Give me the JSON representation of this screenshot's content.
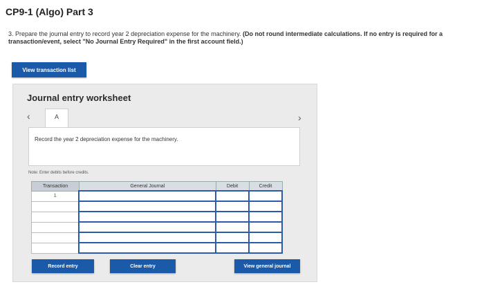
{
  "title": "CP9-1 (Algo) Part 3",
  "question": {
    "text": "3. Prepare the journal entry to record year 2 depreciation expense for the machinery.",
    "bold": "(Do not round intermediate calculations. If no entry is required for a transaction/event, select \"No Journal Entry Required\" in the first account field.)"
  },
  "view_transaction_label": "View transaction list",
  "worksheet": {
    "title": "Journal entry worksheet",
    "prev_icon": "chevron-left-icon",
    "next_icon": "chevron-right-icon",
    "tab_label": "A",
    "description": "Record the year 2 depreciation expense for the machinery.",
    "note": "Note: Enter debits before credits."
  },
  "table": {
    "headers": [
      "Transaction",
      "General Journal",
      "Debit",
      "Credit"
    ],
    "rows": [
      [
        "1",
        "",
        "",
        ""
      ],
      [
        "",
        "",
        "",
        ""
      ],
      [
        "",
        "",
        "",
        ""
      ],
      [
        "",
        "",
        "",
        ""
      ],
      [
        "",
        "",
        "",
        ""
      ],
      [
        "",
        "",
        "",
        ""
      ]
    ]
  },
  "buttons": {
    "record": "Record entry",
    "clear": "Clear entry",
    "view_journal": "View general journal"
  },
  "colors": {
    "accent": "#1b5aa8"
  }
}
